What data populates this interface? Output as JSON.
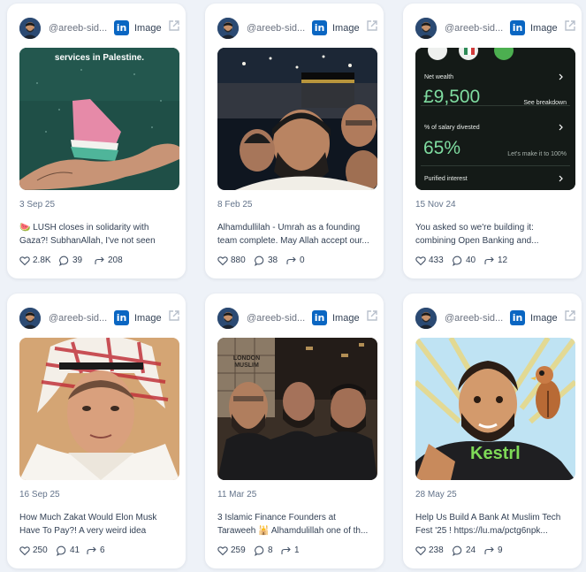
{
  "colors": {
    "background": "#eef2f8",
    "card": "#ffffff",
    "linkedin": "#0a66c2",
    "text": "#334155",
    "muted": "#64748b"
  },
  "posts": [
    {
      "handle": "@areeb-sid...",
      "platform_icon": "linkedin-icon",
      "type_label": "Image",
      "image_text": "services in Palestine.",
      "date": "3 Sep 25",
      "excerpt": "🍉 LUSH closes in solidarity with Gaza?! SubhanAllah, I've not seen another...",
      "likes": "2.8K",
      "comments": "39",
      "shares": "208"
    },
    {
      "handle": "@areeb-sid...",
      "platform_icon": "linkedin-icon",
      "type_label": "Image",
      "date": "8 Feb 25",
      "excerpt": "Alhamdullilah - Umrah as a founding team complete. May Allah accept our...",
      "likes": "880",
      "comments": "38",
      "shares": "0"
    },
    {
      "handle": "@areeb-sid...",
      "platform_icon": "linkedin-icon",
      "type_label": "Image",
      "image_ui": {
        "net_wealth_label": "Net wealth",
        "net_wealth_value": "£9,500",
        "see_breakdown": "See breakdown",
        "salary_label": "% of salary divested",
        "salary_value": "65%",
        "salary_note": "Let's make it to 100%",
        "purified_label": "Purified interest"
      },
      "date": "15 Nov 24",
      "excerpt": "You asked so we're building it: combining Open Banking and...",
      "likes": "433",
      "comments": "40",
      "shares": "12"
    },
    {
      "handle": "@areeb-sid...",
      "platform_icon": "linkedin-icon",
      "type_label": "Image",
      "date": "16 Sep 25",
      "excerpt": "How Much Zakat Would Elon Musk Have To Pay?! A very weird idea right?...",
      "likes": "250",
      "comments": "41",
      "shares": "6"
    },
    {
      "handle": "@areeb-sid...",
      "platform_icon": "linkedin-icon",
      "type_label": "Image",
      "image_text": "LONDON MUSLIM",
      "date": "11 Mar 25",
      "excerpt": "3 Islamic Finance Founders at Taraweeh 🕌 Alhamdulillah one of th...",
      "likes": "259",
      "comments": "8",
      "shares": "1"
    },
    {
      "handle": "@areeb-sid...",
      "platform_icon": "linkedin-icon",
      "type_label": "Image",
      "image_text": "Kestrl",
      "date": "28 May 25",
      "excerpt": "Help Us Build A Bank At Muslim Tech Fest '25 ! https://lu.ma/pctg6npk...",
      "likes": "238",
      "comments": "24",
      "shares": "9"
    }
  ]
}
